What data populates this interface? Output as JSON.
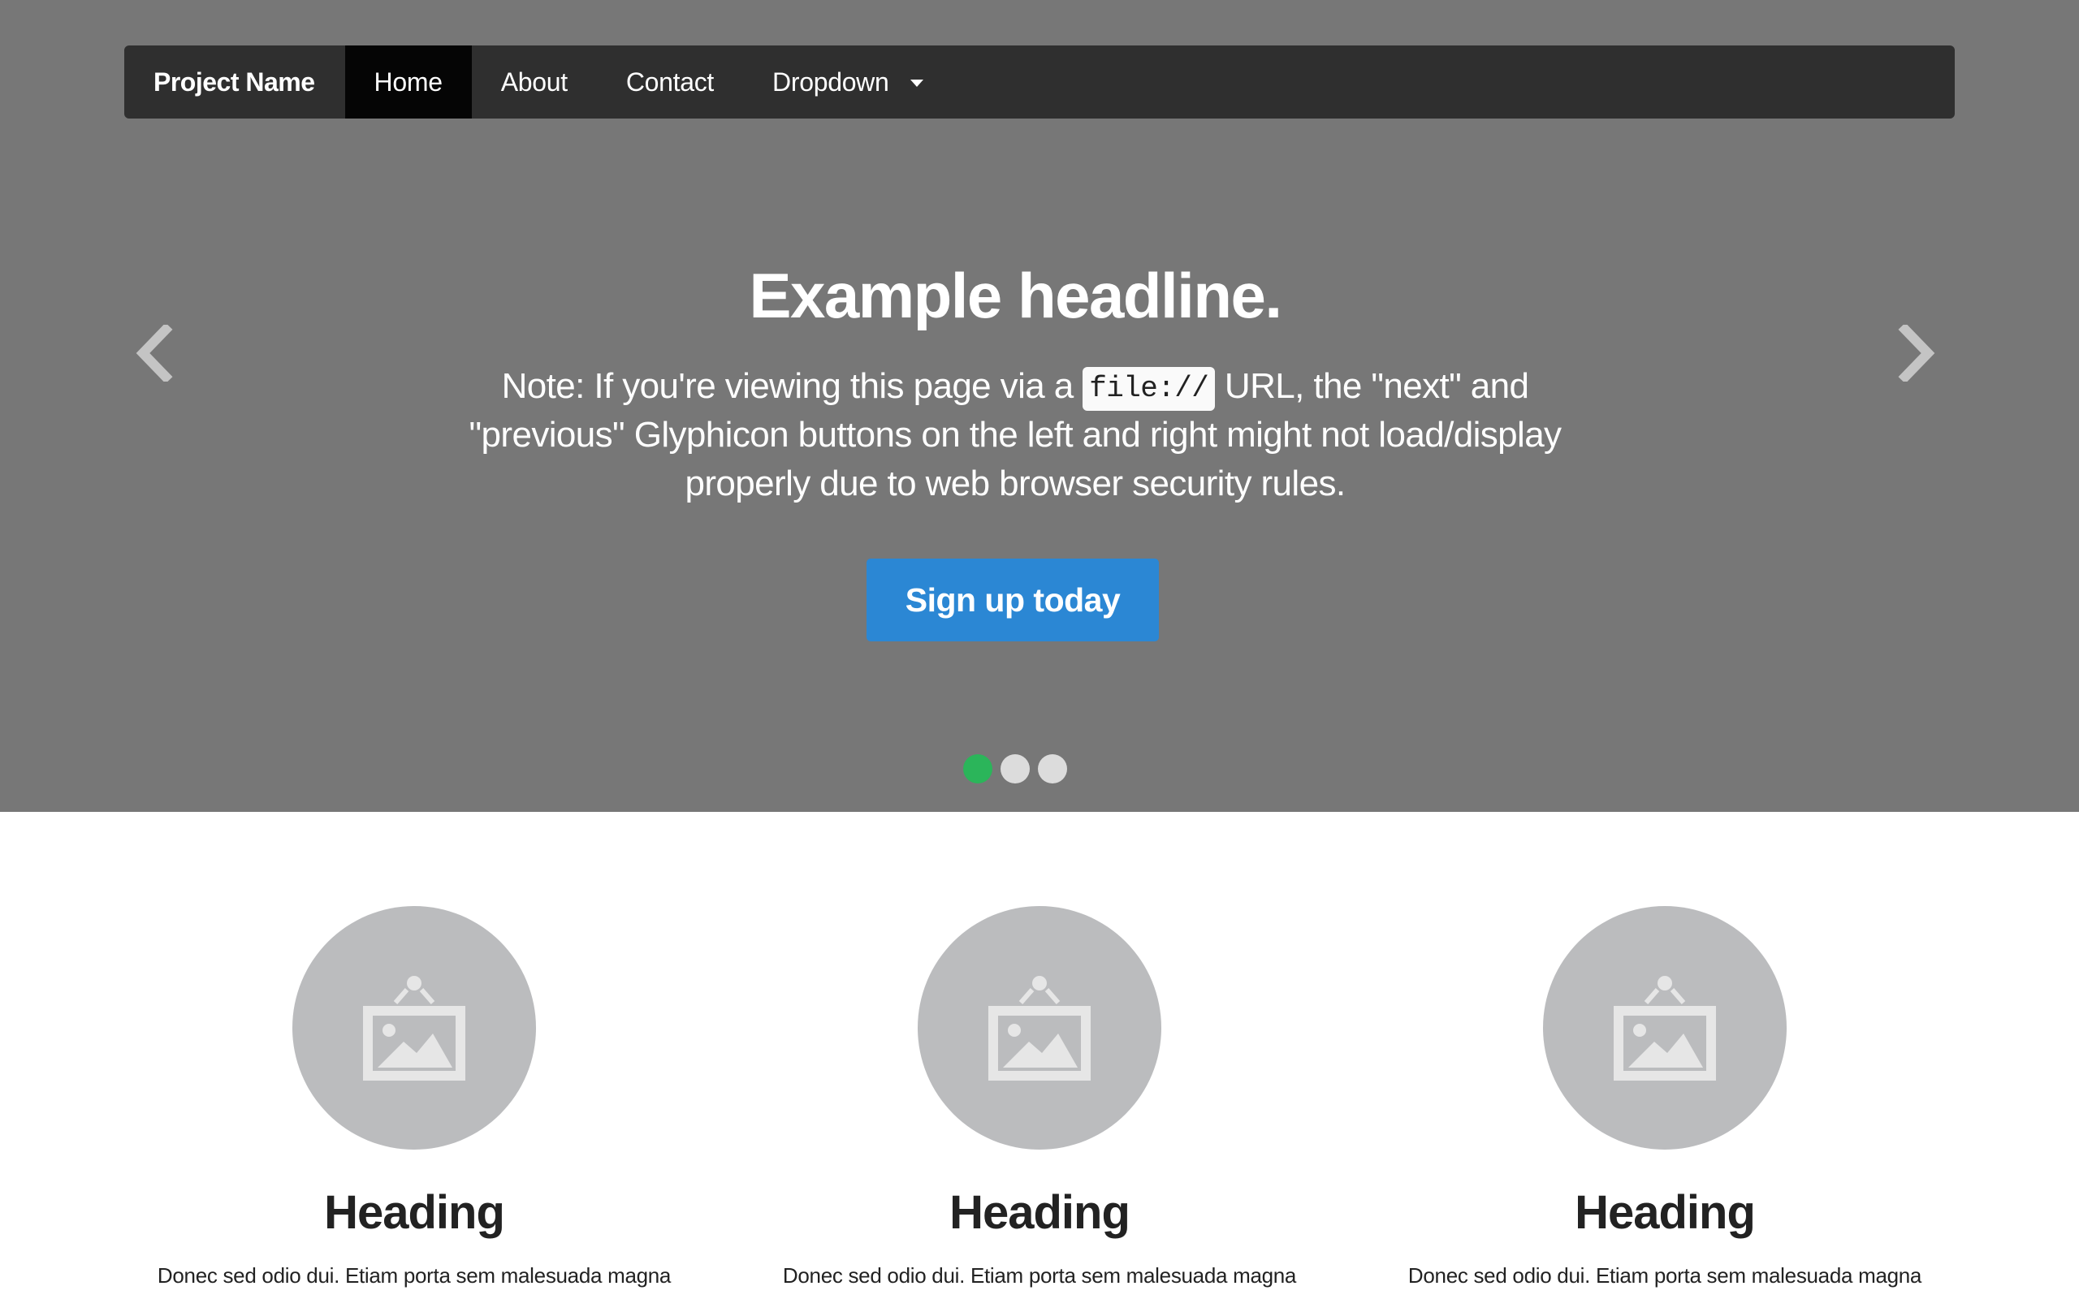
{
  "navbar": {
    "brand": "Project Name",
    "items": [
      {
        "label": "Home",
        "active": true
      },
      {
        "label": "About"
      },
      {
        "label": "Contact"
      },
      {
        "label": "Dropdown"
      }
    ]
  },
  "carousel": {
    "headline": "Example headline.",
    "note_before": "Note: If you're viewing this page via a ",
    "note_code": "file://",
    "note_after": " URL, the \"next\" and \"previous\" Glyphicon buttons on the left and right might not load/display properly due to web browser security rules.",
    "button_label": "Sign up today",
    "indicator_count": 3,
    "active_indicator": 0
  },
  "columns": [
    {
      "heading": "Heading",
      "text": "Donec sed odio dui. Etiam porta sem malesuada magna"
    },
    {
      "heading": "Heading",
      "text": "Donec sed odio dui. Etiam porta sem malesuada magna"
    },
    {
      "heading": "Heading",
      "text": "Donec sed odio dui. Etiam porta sem malesuada magna"
    }
  ],
  "colors": {
    "hero_bg": "#777777",
    "navbar_bg": "#2f2f2f",
    "active_nav_bg": "#050505",
    "button": "#2b87d4",
    "active_dot": "#2bb55a",
    "placeholder_circle": "#bbbcbe"
  }
}
